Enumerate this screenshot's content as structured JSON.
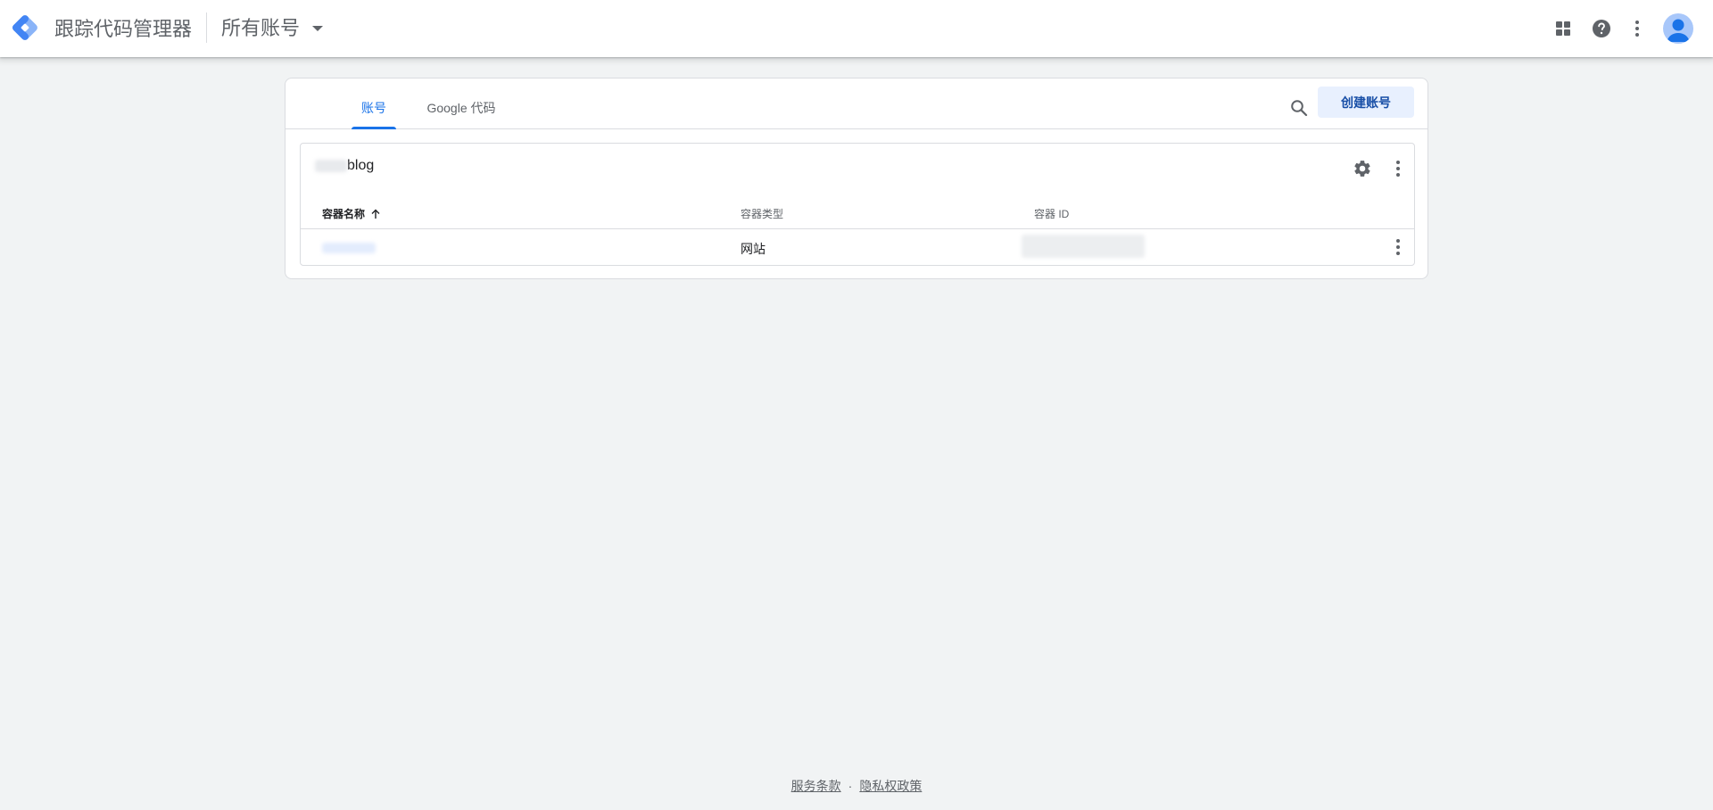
{
  "appbar": {
    "product_name": "跟踪代码管理器",
    "account_switcher_label": "所有账号",
    "icons": [
      "apps-grid-icon",
      "help-icon",
      "more-vert-icon",
      "account-avatar-icon"
    ]
  },
  "tabs": [
    {
      "label": "账号",
      "active": true
    },
    {
      "label": "Google 代码",
      "active": false
    }
  ],
  "toolbar": {
    "search_icon": "search-icon",
    "create_account_label": "创建账号"
  },
  "account": {
    "name_suffix": "blog",
    "name_prefix_blurred": true,
    "icons": [
      "settings-gear-icon",
      "more-vert-icon"
    ]
  },
  "table": {
    "columns": [
      {
        "label": "容器名称",
        "sorted": "ascending"
      },
      {
        "label": "容器类型"
      },
      {
        "label": "容器 ID"
      }
    ],
    "rows": [
      {
        "container_name_blurred": true,
        "container_type": "网站",
        "container_id_blurred": true
      }
    ]
  },
  "footer": {
    "terms_label": "服务条款",
    "separator": "·",
    "privacy_label": "隐私权政策"
  },
  "colors": {
    "accent": "#1a73e8",
    "background": "#f1f3f4",
    "create_button_bg": "#e8f0fe",
    "create_button_text": "#174ea6",
    "avatar_bg": "#a8c7fa"
  }
}
